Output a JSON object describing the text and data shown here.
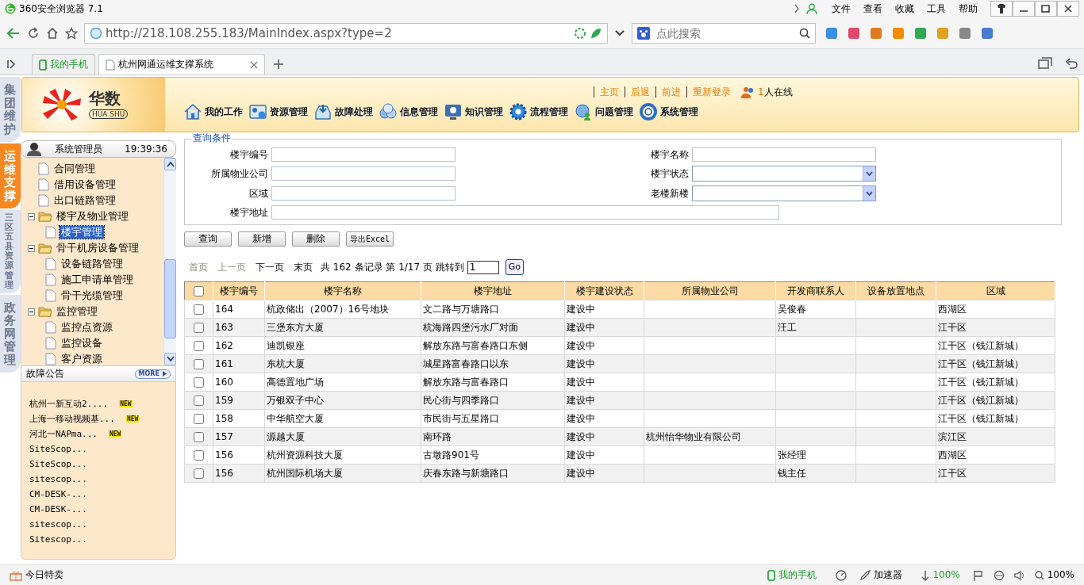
{
  "browser": {
    "title": "360安全浏览器 7.1",
    "menu": [
      "文件",
      "查看",
      "收藏",
      "工具",
      "帮助"
    ],
    "url": "http://218.108.255.183/MainIndex.aspx?type=2",
    "search": {
      "placeholder": "点此搜索"
    },
    "tabs": [
      {
        "label": "我的手机",
        "selected": false,
        "kind": "phone"
      },
      {
        "label": "杭州网通运维支撑系统",
        "selected": true,
        "kind": "page"
      }
    ]
  },
  "side_tabs": [
    {
      "label": "集团维护",
      "selected": false
    },
    {
      "label": "运维支撑",
      "selected": true
    },
    {
      "label": "三区五县资源管理",
      "selected": false
    },
    {
      "label": "政务网管理",
      "selected": false
    }
  ],
  "header": {
    "logo": {
      "text": "华数",
      "subtext": "HUA SHU"
    },
    "links": [
      "主页",
      "后退",
      "前进",
      "重新登录"
    ],
    "online": {
      "count": "1",
      "label": "人在线"
    },
    "menu": [
      "我的工作",
      "资源管理",
      "故障处理",
      "信息管理",
      "知识管理",
      "流程管理",
      "问题管理",
      "系统管理"
    ]
  },
  "user": {
    "name": "系统管理员",
    "time": "19:39:36"
  },
  "tree": [
    {
      "label": "合同管理",
      "selected": false
    },
    {
      "label": "借用设备管理",
      "selected": false
    },
    {
      "label": "出口链路管理",
      "selected": false
    },
    {
      "label": "楼宇及物业管理",
      "expanded": true,
      "children": [
        {
          "label": "楼宇管理",
          "selected": true
        }
      ]
    },
    {
      "label": "骨干机房设备管理",
      "expanded": true,
      "children": [
        {
          "label": "设备链路管理",
          "selected": false
        },
        {
          "label": "施工申请单管理",
          "selected": false
        },
        {
          "label": "骨干光缆管理",
          "selected": false
        }
      ]
    },
    {
      "label": "监控管理",
      "expanded": true,
      "children": [
        {
          "label": "监控点资源",
          "selected": false
        },
        {
          "label": "监控设备",
          "selected": false
        },
        {
          "label": "客户资源",
          "selected": false
        }
      ]
    }
  ],
  "notices": {
    "title": "故障公告",
    "more": "MORE",
    "items": [
      {
        "text": "杭州一新互动2....",
        "badge": "NEW"
      },
      {
        "text": "上海一移动视频基...",
        "badge": "NEW"
      },
      {
        "text": "河北一NAPma...",
        "badge": "NEW"
      },
      {
        "text": "SiteScop..."
      },
      {
        "text": "SiteScop..."
      },
      {
        "text": "sitescop..."
      },
      {
        "text": "CM-DESK-..."
      },
      {
        "text": "CM-DESK-..."
      },
      {
        "text": "sitescop..."
      },
      {
        "text": "Sitescop..."
      }
    ]
  },
  "query": {
    "legend": "查询条件",
    "fields": [
      {
        "label": "楼宇编号",
        "kind": "text"
      },
      {
        "label": "楼宇名称",
        "kind": "text"
      },
      {
        "label": "所属物业公司",
        "kind": "text"
      },
      {
        "label": "楼宇状态",
        "kind": "select"
      },
      {
        "label": "区域",
        "kind": "text"
      },
      {
        "label": "老楼新楼",
        "kind": "select"
      },
      {
        "label": "楼宇地址",
        "kind": "wide"
      }
    ]
  },
  "buttons": [
    "查询",
    "新增",
    "删除",
    "导出Excel"
  ],
  "pager": {
    "links": [
      {
        "label": "首页",
        "disabled": true
      },
      {
        "label": "上一页",
        "disabled": true
      },
      {
        "label": "下一页",
        "disabled": false
      },
      {
        "label": "末页",
        "disabled": false
      }
    ],
    "summary": "共 162 条记录 第 1/17 页 跳转到",
    "page_input": "1",
    "go": "Go"
  },
  "table": {
    "header_checked": false,
    "columns": [
      "楼宇编号",
      "楼宇名称",
      "楼宇地址",
      "楼宇建设状态",
      "所属物业公司",
      "开发商联系人",
      "设备放置地点",
      "区域"
    ],
    "rows": [
      {
        "checked": false,
        "cells": [
          "164",
          "杭政储出（2007）16号地块",
          "文二路与万塘路口",
          "建设中",
          "",
          "吴俊春",
          "",
          "西湖区"
        ]
      },
      {
        "checked": false,
        "cells": [
          "163",
          "三堡东方大厦",
          "杭海路四堡污水厂对面",
          "建设中",
          "",
          "汪工",
          "",
          "江干区"
        ]
      },
      {
        "checked": false,
        "cells": [
          "162",
          "迪凯银座",
          "解放东路与富春路口东侧",
          "建设中",
          "",
          "",
          "",
          "江干区（钱江新城）"
        ]
      },
      {
        "checked": false,
        "cells": [
          "161",
          "东杭大厦",
          "城星路富春路口以东",
          "建设中",
          "",
          "",
          "",
          "江干区（钱江新城）"
        ]
      },
      {
        "checked": false,
        "cells": [
          "160",
          "高德置地广场",
          "解放东路与富春路口",
          "建设中",
          "",
          "",
          "",
          "江干区（钱江新城）"
        ]
      },
      {
        "checked": false,
        "cells": [
          "159",
          "万银双子中心",
          "民心街与四季路口",
          "建设中",
          "",
          "",
          "",
          "江干区（钱江新城）"
        ]
      },
      {
        "checked": false,
        "cells": [
          "158",
          "中华航空大厦",
          "市民街与五星路口",
          "建设中",
          "",
          "",
          "",
          "江干区（钱江新城）"
        ]
      },
      {
        "checked": false,
        "cells": [
          "157",
          "源越大厦",
          "南环路",
          "建设中",
          "杭州怡华物业有限公司",
          "",
          "",
          "滨江区"
        ]
      },
      {
        "checked": false,
        "cells": [
          "156",
          "杭州资源科技大厦",
          "古墩路901号",
          "建设中",
          "",
          "张经理",
          "",
          "西湖区"
        ]
      },
      {
        "checked": false,
        "cells": [
          "156",
          "杭州国际机场大厦",
          "庆春东路与新塘路口",
          "建设中",
          "",
          "钱主任",
          "",
          "江干区"
        ]
      }
    ]
  },
  "status_bar": {
    "deals": "今日特卖",
    "phone": "我的手机",
    "accelerator": "加速器",
    "download": "100%",
    "zoom": "100%"
  }
}
